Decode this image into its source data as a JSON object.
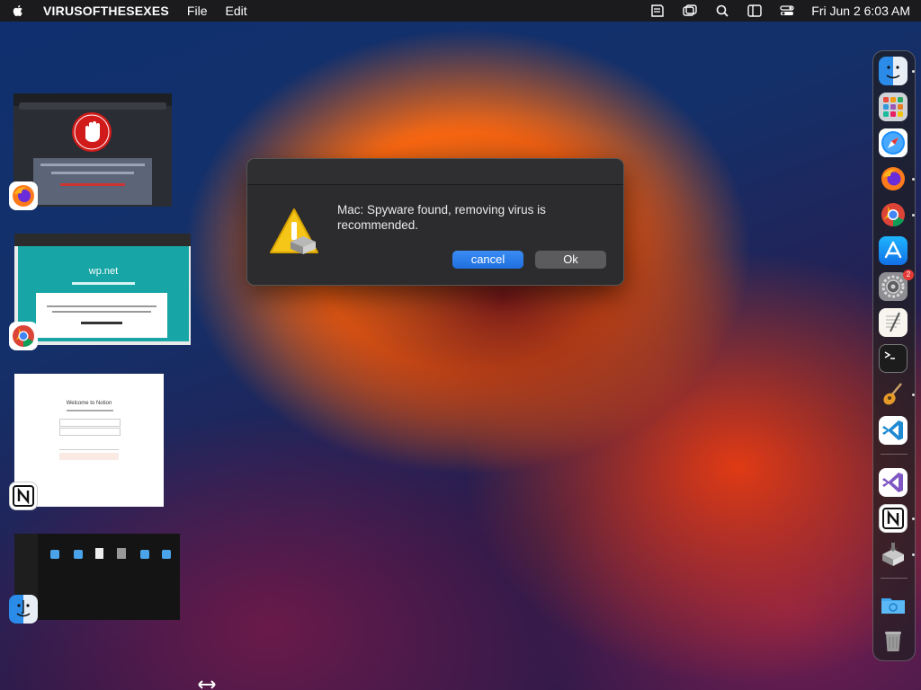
{
  "menubar": {
    "app_name": "VIRUSOFTHESEXES",
    "menus": [
      "File",
      "Edit"
    ],
    "clock": "Fri Jun 2  6:03 AM",
    "status_icons": [
      "notes-icon",
      "window-icon",
      "search-icon",
      "sidebar-icon",
      "control-center-icon"
    ]
  },
  "dialog": {
    "message": "Mac: Spyware found, removing virus is recommended.",
    "cancel_label": "cancel",
    "ok_label": "Ok",
    "accent_color": "#2f80ed"
  },
  "thumbnails": {
    "chrome_site": "wp.net",
    "notion_heading": "Welcome to Notion"
  },
  "dock": {
    "apps": [
      "finder",
      "launchpad",
      "safari",
      "firefox",
      "chrome",
      "app-store",
      "system-settings",
      "textedit",
      "terminal",
      "garageband",
      "vscode",
      "visual-studio",
      "notion",
      "installer",
      "downloads-folder",
      "trash"
    ],
    "settings_badge": "2"
  }
}
